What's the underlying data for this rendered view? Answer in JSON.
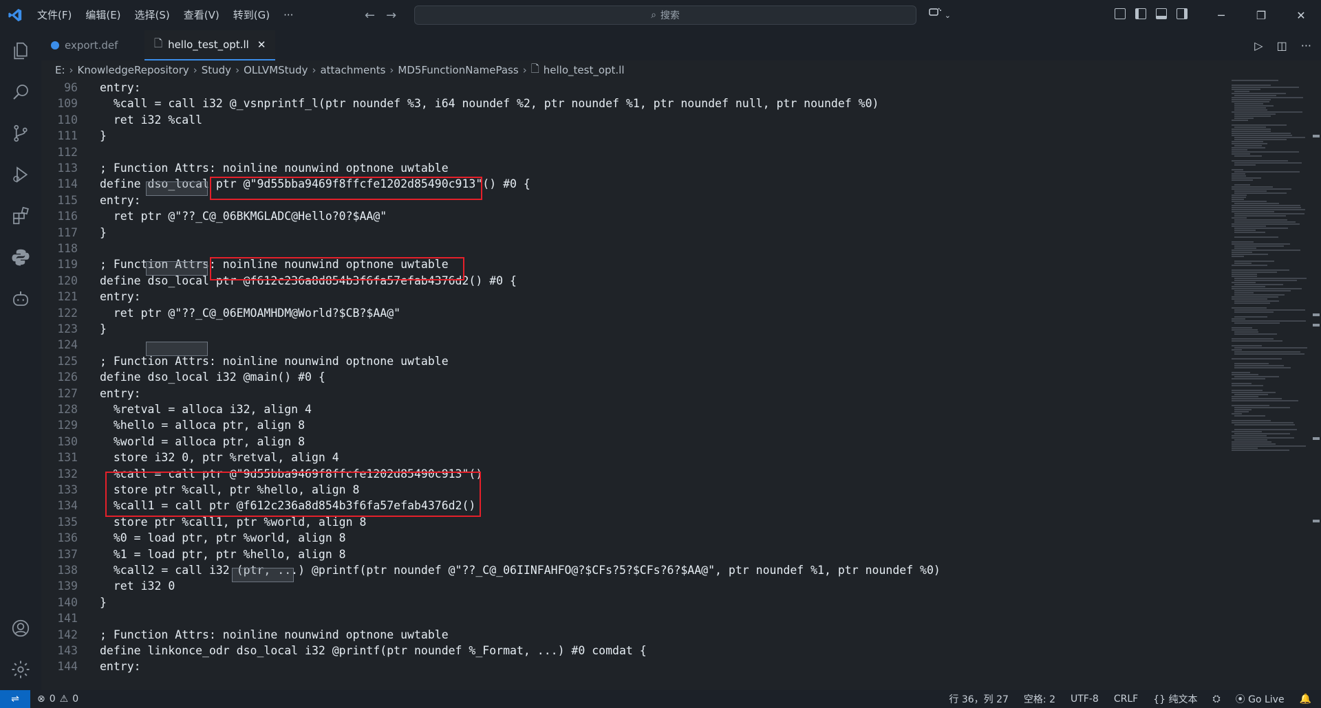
{
  "menu": [
    "文件(F)",
    "编辑(E)",
    "选择(S)",
    "查看(V)",
    "转到(G)",
    "···"
  ],
  "search": {
    "placeholder": "搜索"
  },
  "tabs": [
    {
      "label": "export.def",
      "active": false
    },
    {
      "label": "hello_test_opt.ll",
      "active": true
    }
  ],
  "breadcrumb": [
    "E:",
    "KnowledgeRepository",
    "Study",
    "OLLVMStudy",
    "attachments",
    "MD5FunctionNamePass",
    "hello_test_opt.ll"
  ],
  "editor": {
    "lines": [
      {
        "n": "96",
        "code": "entry:"
      },
      {
        "n": "109",
        "code": "  %call = call i32 @_vsnprintf_l(ptr noundef %3, i64 noundef %2, ptr noundef %1, ptr noundef null, ptr noundef %0)"
      },
      {
        "n": "110",
        "code": "  ret i32 %call"
      },
      {
        "n": "111",
        "code": "}"
      },
      {
        "n": "112",
        "code": ""
      },
      {
        "n": "113",
        "code": "; Function Attrs: noinline nounwind optnone uwtable"
      },
      {
        "n": "114",
        "code": "define dso_local ptr @\"9d55bba9469f8ffcfe1202d85490c913\"() #0 {"
      },
      {
        "n": "115",
        "code": "entry:"
      },
      {
        "n": "116",
        "code": "  ret ptr @\"??_C@_06BKMGLADC@Hello?0?$AA@\""
      },
      {
        "n": "117",
        "code": "}"
      },
      {
        "n": "118",
        "code": ""
      },
      {
        "n": "119",
        "code": "; Function Attrs: noinline nounwind optnone uwtable"
      },
      {
        "n": "120",
        "code": "define dso_local ptr @f612c236a8d854b3f6fa57efab4376d2() #0 {"
      },
      {
        "n": "121",
        "code": "entry:"
      },
      {
        "n": "122",
        "code": "  ret ptr @\"??_C@_06EMOAMHDM@World?$CB?$AA@\""
      },
      {
        "n": "123",
        "code": "}"
      },
      {
        "n": "124",
        "code": ""
      },
      {
        "n": "125",
        "code": "; Function Attrs: noinline nounwind optnone uwtable"
      },
      {
        "n": "126",
        "code": "define dso_local i32 @main() #0 {"
      },
      {
        "n": "127",
        "code": "entry:"
      },
      {
        "n": "128",
        "code": "  %retval = alloca i32, align 4"
      },
      {
        "n": "129",
        "code": "  %hello = alloca ptr, align 8"
      },
      {
        "n": "130",
        "code": "  %world = alloca ptr, align 8"
      },
      {
        "n": "131",
        "code": "  store i32 0, ptr %retval, align 4"
      },
      {
        "n": "132",
        "code": "  %call = call ptr @\"9d55bba9469f8ffcfe1202d85490c913\"()"
      },
      {
        "n": "133",
        "code": "  store ptr %call, ptr %hello, align 8"
      },
      {
        "n": "134",
        "code": "  %call1 = call ptr @f612c236a8d854b3f6fa57efab4376d2()"
      },
      {
        "n": "135",
        "code": "  store ptr %call1, ptr %world, align 8"
      },
      {
        "n": "136",
        "code": "  %0 = load ptr, ptr %world, align 8"
      },
      {
        "n": "137",
        "code": "  %1 = load ptr, ptr %hello, align 8"
      },
      {
        "n": "138",
        "code": "  %call2 = call i32 (ptr, ...) @printf(ptr noundef @\"??_C@_06IINFAHFO@?$CFs?5?$CFs?6?$AA@\", ptr noundef %1, ptr noundef %0)"
      },
      {
        "n": "139",
        "code": "  ret i32 0"
      },
      {
        "n": "140",
        "code": "}"
      },
      {
        "n": "141",
        "code": ""
      },
      {
        "n": "142",
        "code": "; Function Attrs: noinline nounwind optnone uwtable"
      },
      {
        "n": "143",
        "code": "define linkonce_odr dso_local i32 @printf(ptr noundef %_Format, ...) #0 comdat {"
      },
      {
        "n": "144",
        "code": "entry:"
      }
    ]
  },
  "status": {
    "problems": {
      "errors": "0",
      "warnings": "0"
    },
    "cursor": "行 36，列 27",
    "spaces": "空格: 2",
    "encoding": "UTF-8",
    "eol": "CRLF",
    "language": "纯文本",
    "golive": "Go Live"
  },
  "colors": {
    "accent": "#3b8eea",
    "highlight_box": "#e5202a",
    "remote": "#0a66c2"
  }
}
